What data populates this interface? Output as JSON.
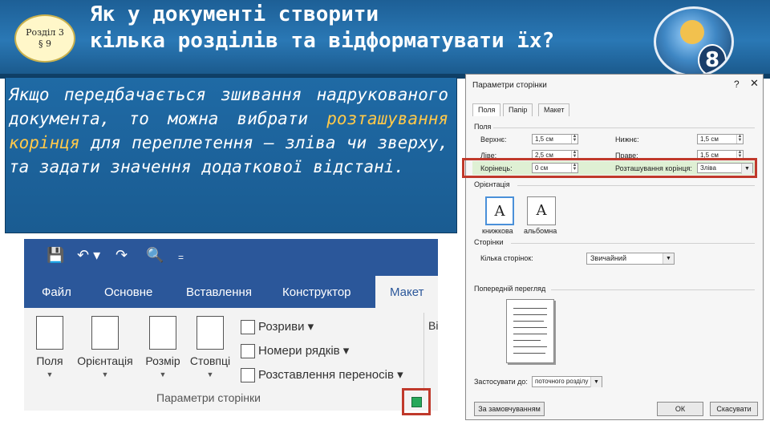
{
  "slide": {
    "badge_line1": "Розділ 3",
    "badge_line2": "§ 9",
    "title_line1": "Як у документі створити",
    "title_line2": "кілька розділів та відформатувати їх?",
    "logo_number": "8"
  },
  "paragraph": {
    "part1": "Якщо передбачається зшивання надрукованого документа, то можна вибрати ",
    "highlight": "розташування корінця",
    "part2": " для переплетення — зліва чи зверху, та задати значення додаткової відстані."
  },
  "ribbon": {
    "tabs": [
      "Файл",
      "Основне",
      "Вставлення",
      "Конструктор",
      "Макет"
    ],
    "buttons": [
      "Поля",
      "Орієнтація",
      "Розмір",
      "Стовпці"
    ],
    "rows": [
      "Розриви",
      "Номери рядків",
      "Розставлення переносів"
    ],
    "group_label": "Параметри сторінки",
    "extra_label": "Ві"
  },
  "dialog": {
    "title": "Параметри сторінки",
    "help": "?",
    "close": "✕",
    "tabs": [
      "Поля",
      "Папір",
      "Макет"
    ],
    "section_margins": "Поля",
    "top_label": "Верхнє:",
    "top_value": "1,5 см",
    "bottom_label": "Нижнє:",
    "bottom_value": "1,5 см",
    "left_label": "Ліве:",
    "left_value": "2,5 см",
    "right_label": "Праве:",
    "right_value": "1,5 см",
    "gutter_label": "Корінець:",
    "gutter_value": "0 см",
    "gutter_pos_label": "Розташування корінця:",
    "gutter_pos_value": "Зліва",
    "section_orientation": "Орієнтація",
    "portrait": "книжкова",
    "landscape": "альбомна",
    "section_pages": "Сторінки",
    "pages_label": "Кілька сторінок:",
    "pages_value": "Звичайний",
    "section_preview": "Попередній перегляд",
    "apply_label": "Застосувати до:",
    "apply_value": "поточного розділу",
    "default_button": "За замовчуванням",
    "ok_button": "ОК",
    "cancel_button": "Скасувати"
  },
  "colors": {
    "accent_blue": "#2b579a",
    "highlight_text": "#ffc94a",
    "red_frame": "#c0392b"
  }
}
